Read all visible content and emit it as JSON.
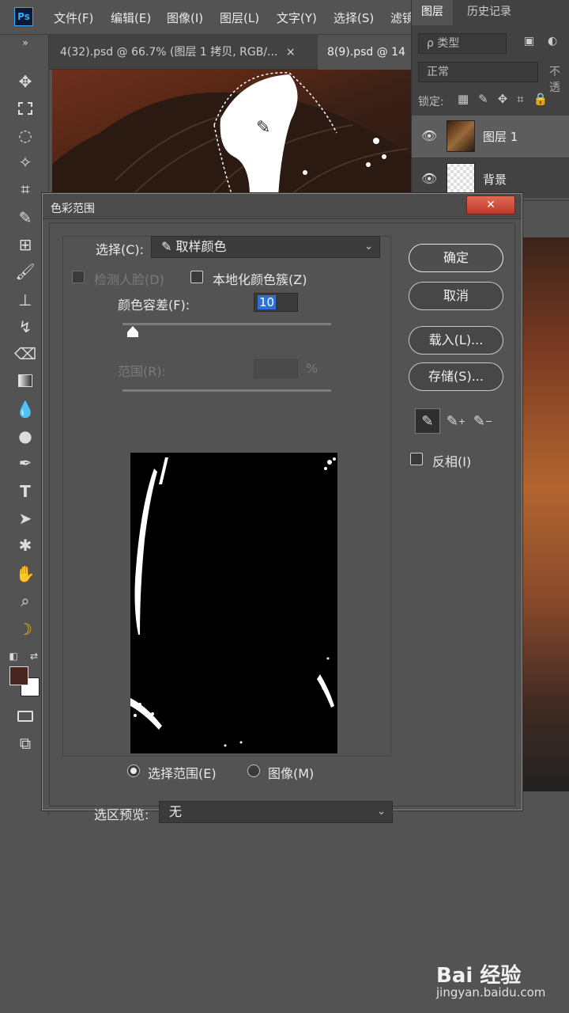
{
  "app": {
    "logo": "Ps"
  },
  "menubar": {
    "items": [
      "文件(F)",
      "编辑(E)",
      "图像(I)",
      "图层(L)",
      "文字(Y)",
      "选择(S)",
      "滤镜"
    ]
  },
  "tabs": [
    {
      "label": "4(32).psd @ 66.7% (图层 1 拷贝, RGB/...",
      "close": "×"
    },
    {
      "label": "8(9).psd @ 14"
    }
  ],
  "panel": {
    "tabs": [
      "图层",
      "历史记录"
    ],
    "filter_placeholder": "ρ 类型",
    "blend_mode": "正常",
    "opacity_label": "不透",
    "lock_label": "锁定:",
    "layers": [
      {
        "name": "图层 1"
      },
      {
        "name": "背景"
      }
    ]
  },
  "dialog": {
    "title": "色彩范围",
    "close": "✕",
    "select_label": "选择(C):",
    "select_value": "取样颜色",
    "detect_faces": "检测人脸(D)",
    "localized": "本地化颜色簇(Z)",
    "fuzziness_label": "颜色容差(F):",
    "fuzziness_value": "10",
    "range_label": "范围(R):",
    "range_unit": "%",
    "radio_selection": "选择范围(E)",
    "radio_image": "图像(M)",
    "preview_label": "选区预览:",
    "preview_value": "无",
    "buttons": {
      "ok": "确定",
      "cancel": "取消",
      "load": "载入(L)...",
      "save": "存储(S)..."
    },
    "invert": "反相(I)"
  },
  "tools": {
    "fg_color": "#4a2520",
    "bg_color": "#ffffff"
  },
  "watermark": {
    "brand": "Bai 经验",
    "url": "jingyan.baidu.com"
  }
}
